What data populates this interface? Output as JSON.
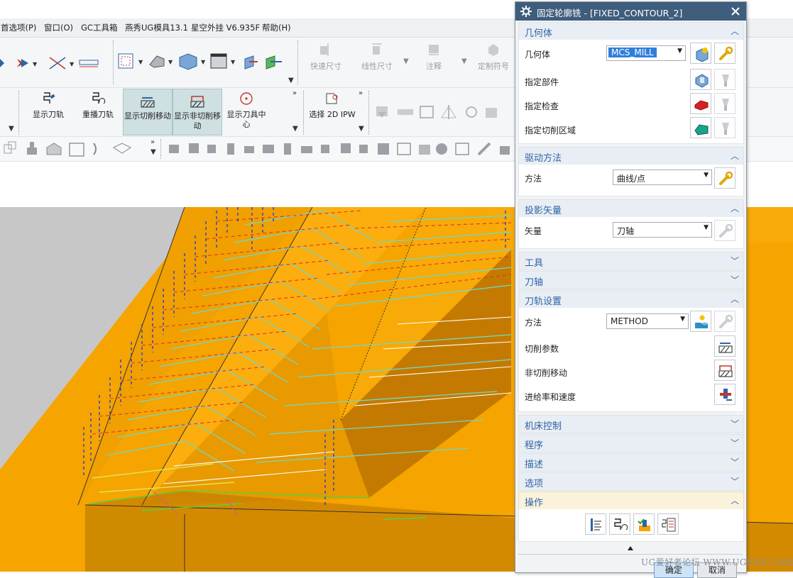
{
  "menubar": {
    "items": [
      "首选项(P)",
      "窗口(O)",
      "GC工具箱",
      "燕秀UG模具13.1",
      "星空外挂 V6.935F",
      "帮助(H)"
    ]
  },
  "toolbar1": {
    "gray_buttons": [
      "快速尺寸",
      "线性尺寸",
      "注释",
      "定制符号"
    ]
  },
  "toolbar2": {
    "buttons": [
      "显示刀轨",
      "重播刀轨",
      "显示切削移动",
      "显示非切削移动",
      "显示刀具中心",
      "选择 2D IPW"
    ]
  },
  "dialog": {
    "title": "固定轮廓铣 - [FIXED_CONTOUR_2]",
    "geometry": {
      "header": "几何体",
      "geometry_label": "几何体",
      "geometry_value": "MCS_MILL",
      "part_label": "指定部件",
      "check_label": "指定检查",
      "cut_area_label": "指定切削区域"
    },
    "drive": {
      "header": "驱动方法",
      "method_label": "方法",
      "method_value": "曲线/点"
    },
    "projection": {
      "header": "投影矢量",
      "vector_label": "矢量",
      "vector_value": "刀轴"
    },
    "collapsed1": [
      "工具",
      "刀轴"
    ],
    "path_settings": {
      "header": "刀轨设置",
      "method_label": "方法",
      "method_value": "METHOD",
      "cut_params": "切削参数",
      "non_cut": "非切削移动",
      "feeds": "进给率和速度"
    },
    "collapsed2": [
      "机床控制",
      "程序",
      "描述",
      "选项"
    ],
    "actions_header": "操作",
    "ok_label": "确定",
    "cancel_label": "取消"
  },
  "watermark": "UG爱好者论坛 WWW.UGSNX.COM",
  "colors": {
    "title_bar": "#3f5d7c",
    "header_text": "#2e64a7",
    "model_orange": "#f5a400",
    "viewport_gray": "#c7c7c7"
  }
}
